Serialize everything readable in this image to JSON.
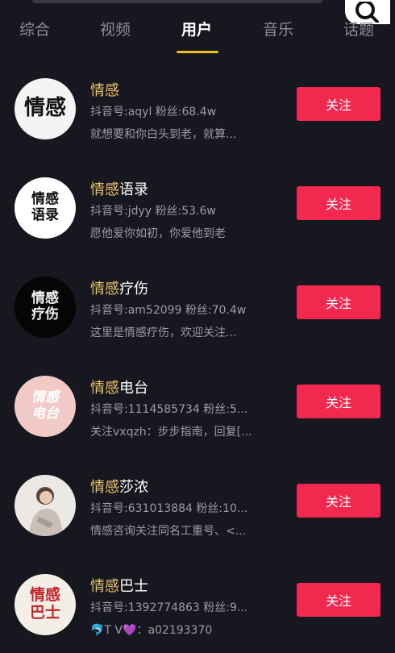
{
  "tabs": [
    {
      "label": "综合",
      "active": false
    },
    {
      "label": "视频",
      "active": false
    },
    {
      "label": "用户",
      "active": true
    },
    {
      "label": "音乐",
      "active": false
    },
    {
      "label": "话题",
      "active": false
    }
  ],
  "search_icon": "search-icon",
  "colors": {
    "background": "#16171f",
    "follow_button": "#f2284f",
    "keyword_highlight": "#e9c46a",
    "tab_indicator": "#f2c21b"
  },
  "users": [
    {
      "name_keyword": "情感",
      "name_rest": "",
      "id_line": "抖音号:aqyl 粉丝:68.4w",
      "bio": "就想要和你白头到老，就算...",
      "avatar_text": "情感",
      "follow_label": "关注"
    },
    {
      "name_keyword": "情感",
      "name_rest": "语录",
      "id_line": "抖音号:jdyy 粉丝:53.6w",
      "bio": "愿他爱你如初，你爱他到老",
      "avatar_text": "情感\n语录",
      "follow_label": "关注"
    },
    {
      "name_keyword": "情感",
      "name_rest": "疗伤",
      "id_line": "抖音号:am52099 粉丝:70.4w",
      "bio": "这里是情感疗伤，欢迎关注...",
      "avatar_text": "情感\n疗伤",
      "follow_label": "关注"
    },
    {
      "name_keyword": "情感",
      "name_rest": "电台",
      "id_line": "抖音号:1114585734 粉丝:5...",
      "bio": "关注vxqzh：步步指南，回复[...",
      "avatar_text": "情感\n电台",
      "follow_label": "关注"
    },
    {
      "name_keyword": "情感",
      "name_rest": "莎浓",
      "id_line": "抖音号:631013884 粉丝:10...",
      "bio": "情感咨询关注同名工重号、<...",
      "avatar_text": "",
      "follow_label": "关注"
    },
    {
      "name_keyword": "情感",
      "name_rest": "巴士",
      "id_line": "抖音号:1392774863 粉丝:9...",
      "bio": "🐬T V💜：a02193370",
      "avatar_text": "情感\n巴士",
      "follow_label": "关注"
    }
  ]
}
